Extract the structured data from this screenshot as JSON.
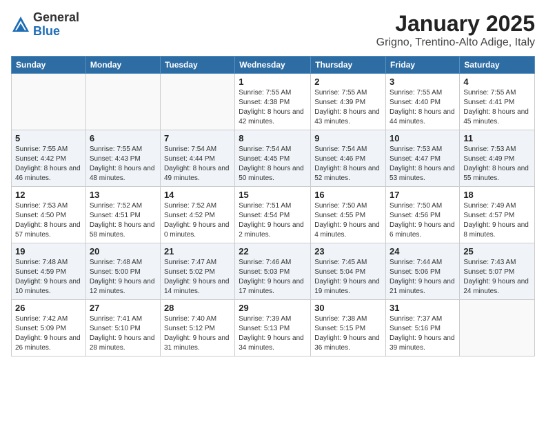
{
  "logo": {
    "general": "General",
    "blue": "Blue"
  },
  "title": "January 2025",
  "location": "Grigno, Trentino-Alto Adige, Italy",
  "weekdays": [
    "Sunday",
    "Monday",
    "Tuesday",
    "Wednesday",
    "Thursday",
    "Friday",
    "Saturday"
  ],
  "weeks": [
    [
      {
        "day": "",
        "info": ""
      },
      {
        "day": "",
        "info": ""
      },
      {
        "day": "",
        "info": ""
      },
      {
        "day": "1",
        "info": "Sunrise: 7:55 AM\nSunset: 4:38 PM\nDaylight: 8 hours and 42 minutes."
      },
      {
        "day": "2",
        "info": "Sunrise: 7:55 AM\nSunset: 4:39 PM\nDaylight: 8 hours and 43 minutes."
      },
      {
        "day": "3",
        "info": "Sunrise: 7:55 AM\nSunset: 4:40 PM\nDaylight: 8 hours and 44 minutes."
      },
      {
        "day": "4",
        "info": "Sunrise: 7:55 AM\nSunset: 4:41 PM\nDaylight: 8 hours and 45 minutes."
      }
    ],
    [
      {
        "day": "5",
        "info": "Sunrise: 7:55 AM\nSunset: 4:42 PM\nDaylight: 8 hours and 46 minutes."
      },
      {
        "day": "6",
        "info": "Sunrise: 7:55 AM\nSunset: 4:43 PM\nDaylight: 8 hours and 48 minutes."
      },
      {
        "day": "7",
        "info": "Sunrise: 7:54 AM\nSunset: 4:44 PM\nDaylight: 8 hours and 49 minutes."
      },
      {
        "day": "8",
        "info": "Sunrise: 7:54 AM\nSunset: 4:45 PM\nDaylight: 8 hours and 50 minutes."
      },
      {
        "day": "9",
        "info": "Sunrise: 7:54 AM\nSunset: 4:46 PM\nDaylight: 8 hours and 52 minutes."
      },
      {
        "day": "10",
        "info": "Sunrise: 7:53 AM\nSunset: 4:47 PM\nDaylight: 8 hours and 53 minutes."
      },
      {
        "day": "11",
        "info": "Sunrise: 7:53 AM\nSunset: 4:49 PM\nDaylight: 8 hours and 55 minutes."
      }
    ],
    [
      {
        "day": "12",
        "info": "Sunrise: 7:53 AM\nSunset: 4:50 PM\nDaylight: 8 hours and 57 minutes."
      },
      {
        "day": "13",
        "info": "Sunrise: 7:52 AM\nSunset: 4:51 PM\nDaylight: 8 hours and 58 minutes."
      },
      {
        "day": "14",
        "info": "Sunrise: 7:52 AM\nSunset: 4:52 PM\nDaylight: 9 hours and 0 minutes."
      },
      {
        "day": "15",
        "info": "Sunrise: 7:51 AM\nSunset: 4:54 PM\nDaylight: 9 hours and 2 minutes."
      },
      {
        "day": "16",
        "info": "Sunrise: 7:50 AM\nSunset: 4:55 PM\nDaylight: 9 hours and 4 minutes."
      },
      {
        "day": "17",
        "info": "Sunrise: 7:50 AM\nSunset: 4:56 PM\nDaylight: 9 hours and 6 minutes."
      },
      {
        "day": "18",
        "info": "Sunrise: 7:49 AM\nSunset: 4:57 PM\nDaylight: 9 hours and 8 minutes."
      }
    ],
    [
      {
        "day": "19",
        "info": "Sunrise: 7:48 AM\nSunset: 4:59 PM\nDaylight: 9 hours and 10 minutes."
      },
      {
        "day": "20",
        "info": "Sunrise: 7:48 AM\nSunset: 5:00 PM\nDaylight: 9 hours and 12 minutes."
      },
      {
        "day": "21",
        "info": "Sunrise: 7:47 AM\nSunset: 5:02 PM\nDaylight: 9 hours and 14 minutes."
      },
      {
        "day": "22",
        "info": "Sunrise: 7:46 AM\nSunset: 5:03 PM\nDaylight: 9 hours and 17 minutes."
      },
      {
        "day": "23",
        "info": "Sunrise: 7:45 AM\nSunset: 5:04 PM\nDaylight: 9 hours and 19 minutes."
      },
      {
        "day": "24",
        "info": "Sunrise: 7:44 AM\nSunset: 5:06 PM\nDaylight: 9 hours and 21 minutes."
      },
      {
        "day": "25",
        "info": "Sunrise: 7:43 AM\nSunset: 5:07 PM\nDaylight: 9 hours and 24 minutes."
      }
    ],
    [
      {
        "day": "26",
        "info": "Sunrise: 7:42 AM\nSunset: 5:09 PM\nDaylight: 9 hours and 26 minutes."
      },
      {
        "day": "27",
        "info": "Sunrise: 7:41 AM\nSunset: 5:10 PM\nDaylight: 9 hours and 28 minutes."
      },
      {
        "day": "28",
        "info": "Sunrise: 7:40 AM\nSunset: 5:12 PM\nDaylight: 9 hours and 31 minutes."
      },
      {
        "day": "29",
        "info": "Sunrise: 7:39 AM\nSunset: 5:13 PM\nDaylight: 9 hours and 34 minutes."
      },
      {
        "day": "30",
        "info": "Sunrise: 7:38 AM\nSunset: 5:15 PM\nDaylight: 9 hours and 36 minutes."
      },
      {
        "day": "31",
        "info": "Sunrise: 7:37 AM\nSunset: 5:16 PM\nDaylight: 9 hours and 39 minutes."
      },
      {
        "day": "",
        "info": ""
      }
    ]
  ]
}
